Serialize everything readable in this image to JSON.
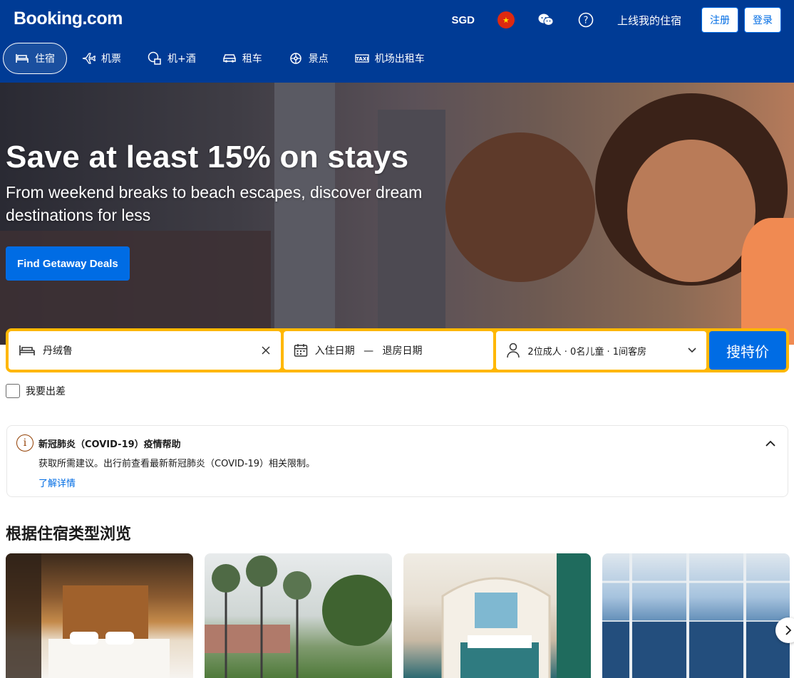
{
  "header": {
    "logo": "Booking.com",
    "currency": "SGD",
    "flag_icon": "china-flag-icon",
    "list_property": "上线我的住宿",
    "register": "注册",
    "login": "登录"
  },
  "nav": {
    "items": [
      {
        "label": "住宿",
        "icon": "bed-icon",
        "active": true
      },
      {
        "label": "机票",
        "icon": "plane-icon"
      },
      {
        "label": "机+酒",
        "icon": "flight-hotel-icon"
      },
      {
        "label": "租车",
        "icon": "car-icon"
      },
      {
        "label": "景点",
        "icon": "attractions-icon"
      },
      {
        "label": "机场出租车",
        "icon": "taxi-icon"
      }
    ]
  },
  "hero": {
    "title": "Save at least 15% on stays",
    "subtitle": "From weekend breaks to beach escapes, discover dream destinations for less",
    "cta": "Find Getaway Deals"
  },
  "search": {
    "destination": "丹绒鲁",
    "checkin": "入住日期",
    "date_sep": "—",
    "checkout": "退房日期",
    "guests": "2位成人 · 0名儿童 · 1间客房",
    "submit": "搜特价"
  },
  "business_trip": "我要出差",
  "covid": {
    "title": "新冠肺炎（COVID-19）疫情帮助",
    "body": "获取所需建议。出行前查看最新新冠肺炎（COVID-19）相关限制。",
    "link": "了解详情"
  },
  "browse": {
    "title": "根据住宿类型浏览"
  },
  "colors": {
    "brand": "#003b95",
    "accent": "#006ce4",
    "search_border": "#ffb700"
  }
}
